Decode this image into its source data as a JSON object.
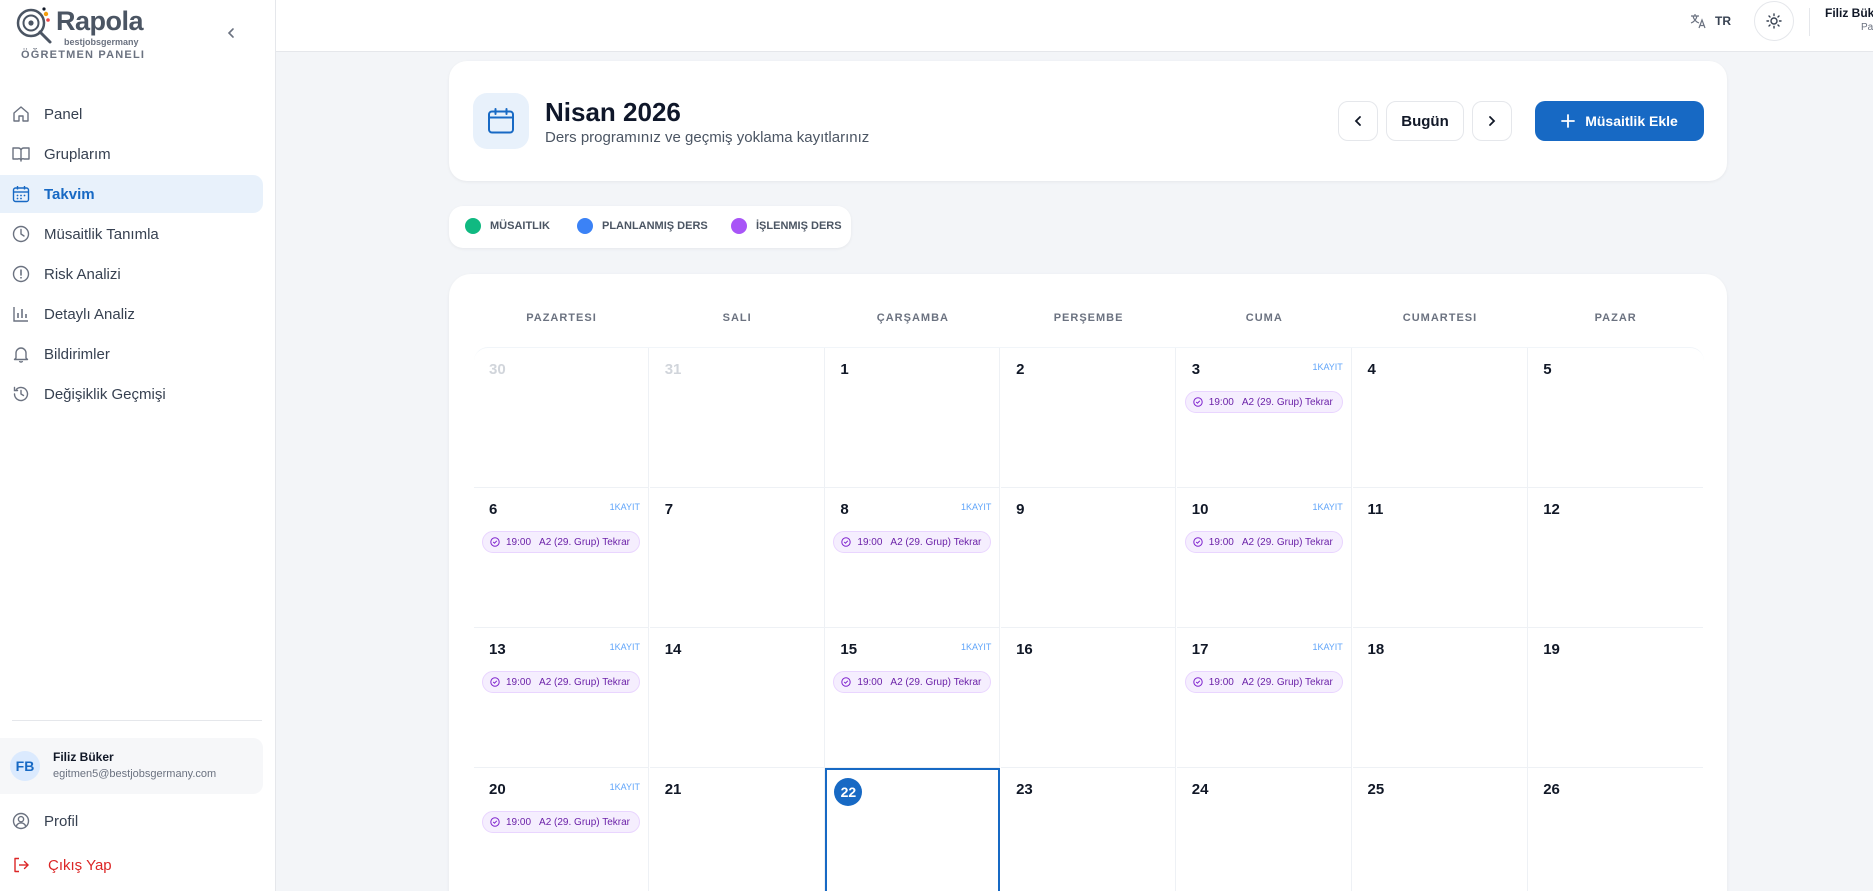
{
  "brand": {
    "name": "Rapola",
    "sub": "bestjobsgermany",
    "panel": "ÖĞRETMEN PANELI"
  },
  "sidebar": {
    "items": [
      {
        "label": "Panel",
        "icon": "home-icon"
      },
      {
        "label": "Gruplarım",
        "icon": "book-icon"
      },
      {
        "label": "Takvim",
        "icon": "calendar-icon",
        "active": true
      },
      {
        "label": "Müsaitlik Tanımla",
        "icon": "clock-icon"
      },
      {
        "label": "Risk Analizi",
        "icon": "alert-icon"
      },
      {
        "label": "Detaylı Analiz",
        "icon": "bar-chart-icon"
      },
      {
        "label": "Bildirimler",
        "icon": "bell-icon"
      },
      {
        "label": "Değişiklik Geçmişi",
        "icon": "history-icon"
      }
    ],
    "user": {
      "initials": "FB",
      "name": "Filiz Büker",
      "email": "egitmen5@bestjobsgermany.com"
    },
    "profile_label": "Profil",
    "logout_label": "Çıkış Yap"
  },
  "topbar": {
    "lang": "TR",
    "user_name": "Filiz Bük",
    "user_role": "Par"
  },
  "header": {
    "title": "Nisan 2026",
    "subtitle": "Ders programınız ve geçmiş yoklama kayıtlarınız",
    "today_label": "Bugün",
    "add_label": "Müsaitlik Ekle"
  },
  "legend": [
    {
      "label": "MÜSAITLIK",
      "color": "#10b981"
    },
    {
      "label": "PLANLANMIŞ DERS",
      "color": "#3b82f6"
    },
    {
      "label": "İŞLENMIŞ DERS",
      "color": "#a855f7"
    }
  ],
  "calendar": {
    "weekdays": [
      "PAZARTESI",
      "SALI",
      "ÇARŞAMBA",
      "PERŞEMBE",
      "CUMA",
      "CUMARTESI",
      "PAZAR"
    ],
    "weeks": [
      [
        {
          "day": "30",
          "other": true
        },
        {
          "day": "31",
          "other": true
        },
        {
          "day": "1"
        },
        {
          "day": "2"
        },
        {
          "day": "3",
          "badge": "1KAYIT",
          "event": {
            "time": "19:00",
            "title": "A2 (29. Grup) Tekrar"
          }
        },
        {
          "day": "4"
        },
        {
          "day": "5"
        }
      ],
      [
        {
          "day": "6",
          "badge": "1KAYIT",
          "event": {
            "time": "19:00",
            "title": "A2 (29. Grup) Tekrar"
          }
        },
        {
          "day": "7"
        },
        {
          "day": "8",
          "badge": "1KAYIT",
          "event": {
            "time": "19:00",
            "title": "A2 (29. Grup) Tekrar"
          }
        },
        {
          "day": "9"
        },
        {
          "day": "10",
          "badge": "1KAYIT",
          "event": {
            "time": "19:00",
            "title": "A2 (29. Grup) Tekrar"
          }
        },
        {
          "day": "11"
        },
        {
          "day": "12"
        }
      ],
      [
        {
          "day": "13",
          "badge": "1KAYIT",
          "event": {
            "time": "19:00",
            "title": "A2 (29. Grup) Tekrar"
          }
        },
        {
          "day": "14"
        },
        {
          "day": "15",
          "badge": "1KAYIT",
          "event": {
            "time": "19:00",
            "title": "A2 (29. Grup) Tekrar"
          }
        },
        {
          "day": "16"
        },
        {
          "day": "17",
          "badge": "1KAYIT",
          "event": {
            "time": "19:00",
            "title": "A2 (29. Grup) Tekrar"
          }
        },
        {
          "day": "18"
        },
        {
          "day": "19"
        }
      ],
      [
        {
          "day": "20",
          "badge": "1KAYIT",
          "event": {
            "time": "19:00",
            "title": "A2 (29. Grup) Tekrar"
          }
        },
        {
          "day": "21"
        },
        {
          "day": "22",
          "today": true
        },
        {
          "day": "23"
        },
        {
          "day": "24"
        },
        {
          "day": "25"
        },
        {
          "day": "26"
        }
      ]
    ]
  },
  "colors": {
    "accent": "#1769c4",
    "event_text": "#6b21a8",
    "logout": "#dc2626"
  }
}
